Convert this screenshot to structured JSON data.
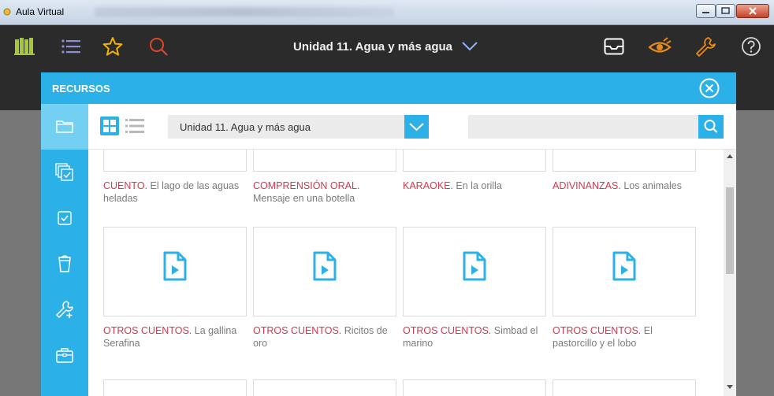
{
  "window": {
    "title": "Aula Virtual"
  },
  "appbar": {
    "unit_title": "Unidad 11. Agua y más agua"
  },
  "modal": {
    "title": "RECURSOS",
    "select_value": "Unidad 11. Agua y más agua",
    "search_placeholder": ""
  },
  "row1": [
    {
      "category": "CUENTO.",
      "title": "El lago de las aguas heladas"
    },
    {
      "category": "COMPRENSIÓN ORAL.",
      "title": "Mensaje en una botella"
    },
    {
      "category": "KARAOKE.",
      "title": "En la orilla"
    },
    {
      "category": "ADIVINANZAS.",
      "title": "Los animales"
    }
  ],
  "row2": [
    {
      "category": "OTROS CUENTOS.",
      "title": "La gallina Serafina"
    },
    {
      "category": "OTROS CUENTOS.",
      "title": "Ricitos de oro"
    },
    {
      "category": "OTROS CUENTOS.",
      "title": "Simbad el marino"
    },
    {
      "category": "OTROS CUENTOS.",
      "title": "El pastorcillo y el lobo"
    }
  ],
  "colors": {
    "accent": "#2cb0e8",
    "category_red": "#d1394e",
    "appbar": "#2b2b2b",
    "star": "#f2b400",
    "search_red": "#e0452c",
    "tool_orange": "#e58a1f"
  },
  "icons": [
    "books-icon",
    "menu-icon",
    "star-icon",
    "search-icon",
    "inbox-icon",
    "eye-icon",
    "wrench-icon",
    "help-icon",
    "close-icon",
    "folder-icon",
    "tasks-icon",
    "check-icon",
    "cup-icon",
    "tools-icon",
    "briefcase-icon",
    "grid-view-icon",
    "list-view-icon",
    "chevron-down-icon",
    "video-file-icon"
  ]
}
